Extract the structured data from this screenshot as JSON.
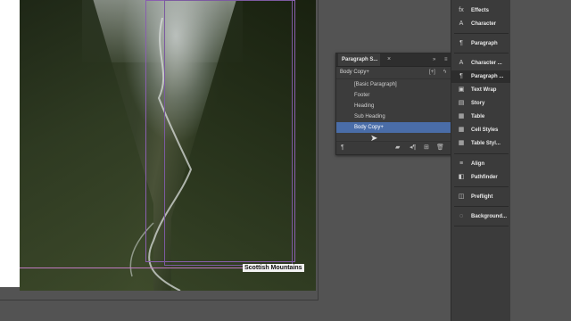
{
  "document": {
    "caption": "Scottish Mountains"
  },
  "paragraph_panel": {
    "tab_title": "Paragraph S...",
    "close_glyph": "×",
    "collapse_glyph": "»",
    "menu_glyph": "≡",
    "current_style": "Body Copy+",
    "styles": [
      {
        "label": "[Basic Paragraph]",
        "selected": false
      },
      {
        "label": "Footer",
        "selected": false
      },
      {
        "label": "Heading",
        "selected": false
      },
      {
        "label": "Sub Heading",
        "selected": false
      },
      {
        "label": "Body Copy+",
        "selected": true
      }
    ]
  },
  "dock": {
    "items": [
      {
        "label": "Effects",
        "icon": "fx-icon",
        "glyph": "fx"
      },
      {
        "label": "Character",
        "icon": "character-icon",
        "glyph": "A"
      },
      {
        "label": "Paragraph",
        "icon": "paragraph-icon",
        "glyph": "¶"
      },
      {
        "label": "Character ...",
        "icon": "character-styles-icon",
        "glyph": "A"
      },
      {
        "label": "Paragraph ...",
        "icon": "paragraph-styles-icon",
        "glyph": "¶"
      },
      {
        "label": "Text Wrap",
        "icon": "text-wrap-icon",
        "glyph": "▣"
      },
      {
        "label": "Story",
        "icon": "story-icon",
        "glyph": "▤"
      },
      {
        "label": "Table",
        "icon": "table-icon",
        "glyph": "▦"
      },
      {
        "label": "Cell Styles",
        "icon": "cell-styles-icon",
        "glyph": "▦"
      },
      {
        "label": "Table Styl...",
        "icon": "table-styles-icon",
        "glyph": "▦"
      },
      {
        "label": "Align",
        "icon": "align-icon",
        "glyph": "≡"
      },
      {
        "label": "Pathfinder",
        "icon": "pathfinder-icon",
        "glyph": "◧"
      },
      {
        "label": "Preflight",
        "icon": "preflight-icon",
        "glyph": "◫"
      },
      {
        "label": "Background...",
        "icon": "background-tasks-icon",
        "glyph": "◌"
      }
    ]
  }
}
